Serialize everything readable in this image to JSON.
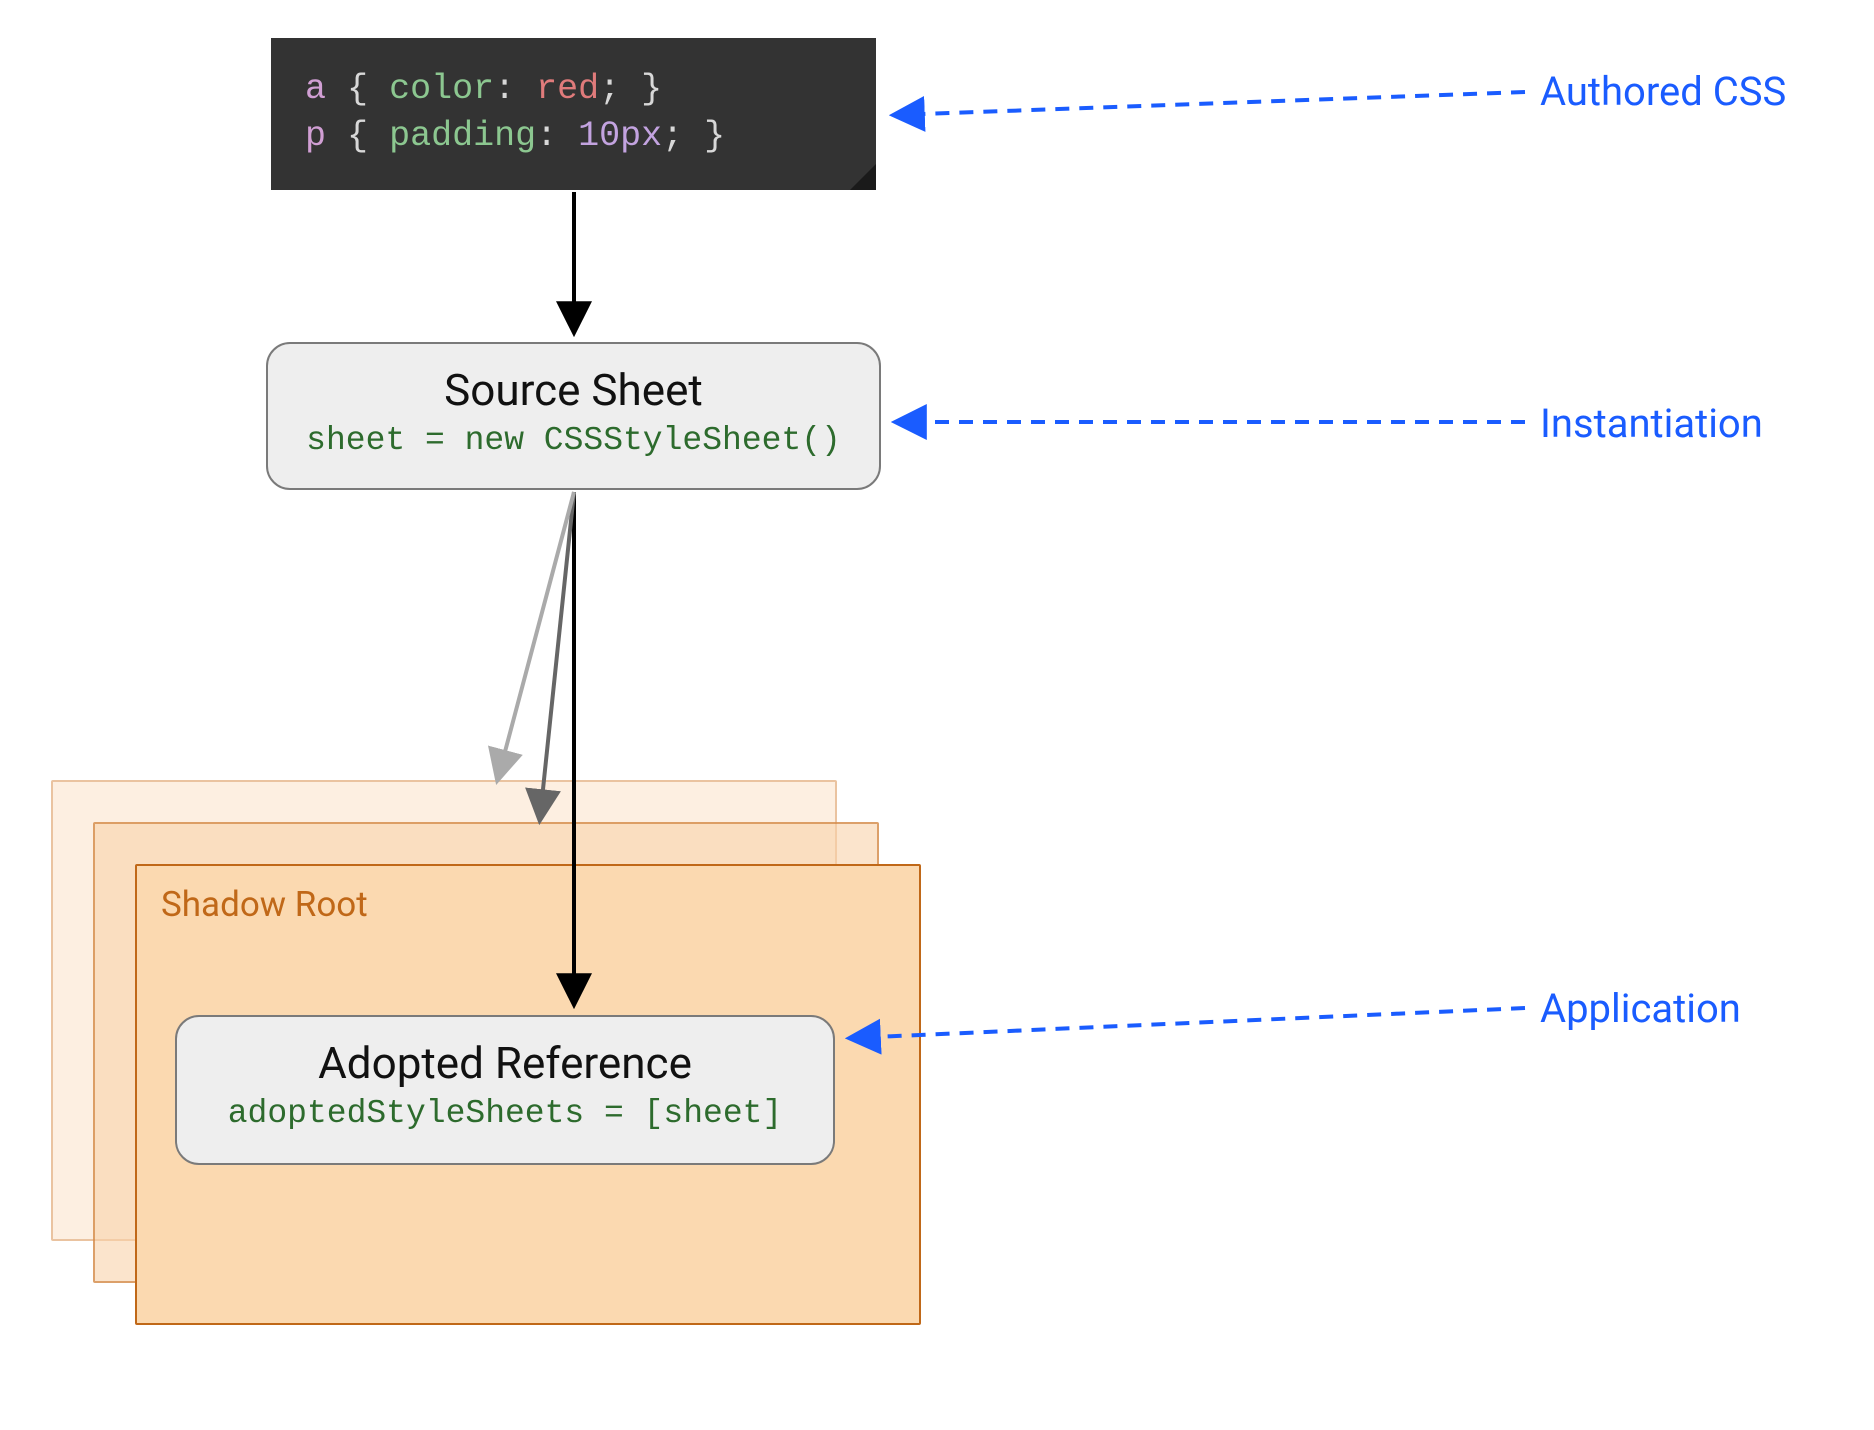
{
  "code": {
    "line1": {
      "selector": "a",
      "brace_open": "{",
      "prop": "color",
      "colon": ":",
      "value": "red",
      "semi": ";",
      "brace_close": "}"
    },
    "line2": {
      "selector": "p",
      "brace_open": "{",
      "prop": "padding",
      "colon": ":",
      "value": "10px",
      "semi": ";",
      "brace_close": "}"
    }
  },
  "source_sheet": {
    "title": "Source Sheet",
    "code": "sheet = new CSSStyleSheet()"
  },
  "shadow_root": {
    "title": "Shadow Root"
  },
  "adopted_ref": {
    "title": "Adopted Reference",
    "code": "adoptedStyleSheets = [sheet]"
  },
  "callouts": {
    "authored": "Authored CSS",
    "instantiation": "Instantiation",
    "application": "Application"
  }
}
